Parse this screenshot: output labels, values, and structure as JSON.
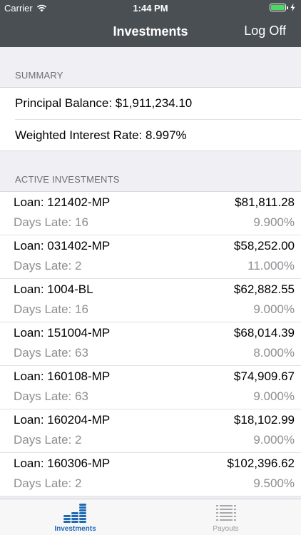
{
  "status_bar": {
    "carrier": "Carrier",
    "time": "1:44 PM"
  },
  "nav": {
    "title": "Investments",
    "logoff_label": "Log Off"
  },
  "summary": {
    "header": "SUMMARY",
    "rows": [
      {
        "text": "Principal Balance: $1,911,234.10"
      },
      {
        "text": "Weighted Interest Rate: 8.997%"
      }
    ]
  },
  "active": {
    "header": "ACTIVE INVESTMENTS",
    "loans": [
      {
        "name": "Loan: 121402-MP",
        "amount": "$81,811.28",
        "days": "Days Late: 16",
        "rate": "9.900%"
      },
      {
        "name": "Loan: 031402-MP",
        "amount": "$58,252.00",
        "days": "Days Late: 2",
        "rate": "11.000%"
      },
      {
        "name": "Loan: 1004-BL",
        "amount": "$62,882.55",
        "days": "Days Late: 16",
        "rate": "9.000%"
      },
      {
        "name": "Loan: 151004-MP",
        "amount": "$68,014.39",
        "days": "Days Late: 63",
        "rate": "8.000%"
      },
      {
        "name": "Loan: 160108-MP",
        "amount": "$74,909.67",
        "days": "Days Late: 63",
        "rate": "9.000%"
      },
      {
        "name": "Loan: 160204-MP",
        "amount": "$18,102.99",
        "days": "Days Late: 2",
        "rate": "9.000%"
      },
      {
        "name": "Loan: 160306-MP",
        "amount": "$102,396.62",
        "days": "Days Late: 2",
        "rate": "9.500%"
      }
    ]
  },
  "tabs": [
    {
      "label": "Investments",
      "icon": "coin-stack-icon",
      "active": true
    },
    {
      "label": "Payouts",
      "icon": "list-icon",
      "active": false
    }
  ],
  "colors": {
    "header_bg": "#4a4f54",
    "accent": "#1f6ab5",
    "battery": "#4cd964"
  }
}
